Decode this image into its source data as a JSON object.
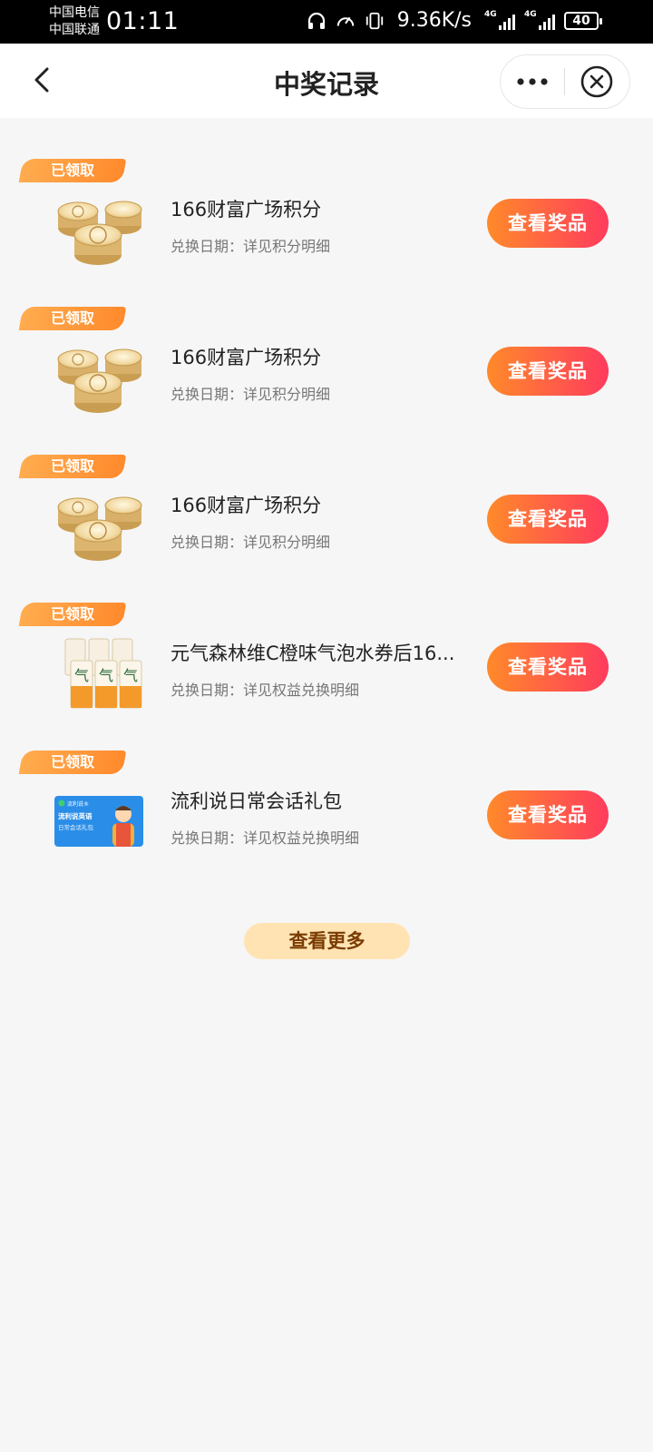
{
  "status_bar": {
    "carrier1": "中国电信",
    "carrier2": "中国联通",
    "time": "01:11",
    "net_speed": "9.36K/s",
    "signal1_tag": "4G",
    "signal2_tag": "4G",
    "battery": "40"
  },
  "header": {
    "title": "中奖记录"
  },
  "records": [
    {
      "badge": "已领取",
      "title": "166财富广场积分",
      "subtitle": "兑换日期：详见积分明细",
      "button": "查看奖品"
    },
    {
      "badge": "已领取",
      "title": "166财富广场积分",
      "subtitle": "兑换日期：详见积分明细",
      "button": "查看奖品"
    },
    {
      "badge": "已领取",
      "title": "166财富广场积分",
      "subtitle": "兑换日期：详见积分明细",
      "button": "查看奖品"
    },
    {
      "badge": "已领取",
      "title": "元气森林维C橙味气泡水券后16...",
      "subtitle": "兑换日期：详见权益兑换明细",
      "button": "查看奖品"
    },
    {
      "badge": "已领取",
      "title": "流利说日常会话礼包",
      "subtitle": "兑换日期：详见权益兑换明细",
      "button": "查看奖品"
    }
  ],
  "card_thumb": {
    "brand": "流利说®",
    "line1": "流利说英语",
    "line2": "日常会话礼包"
  },
  "more_button": "查看更多",
  "colors": {
    "badge": "#ff8a2c",
    "button_start": "#ff8a2a",
    "button_end": "#ff3b5e",
    "more_bg": "#ffe3b2"
  }
}
